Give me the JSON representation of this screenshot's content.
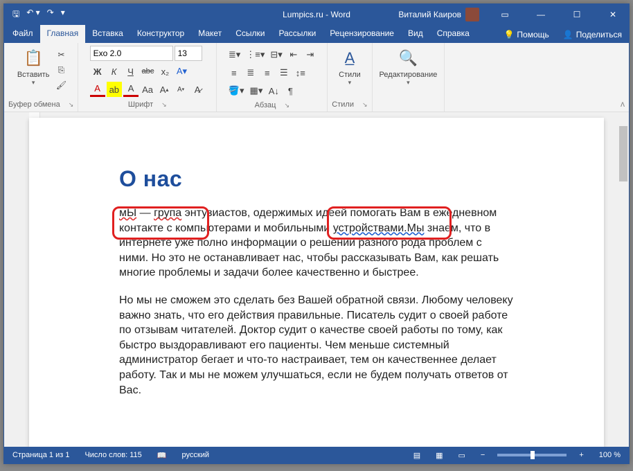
{
  "title": "Lumpics.ru - Word",
  "user_name": "Виталий Каиров",
  "tabs": {
    "file": "Файл",
    "home": "Главная",
    "insert": "Вставка",
    "design": "Конструктор",
    "layout": "Макет",
    "references": "Ссылки",
    "mailings": "Рассылки",
    "review": "Рецензирование",
    "view": "Вид",
    "help": "Справка",
    "tell": "Помощь",
    "share": "Поделиться"
  },
  "ribbon": {
    "clipboard": {
      "label": "Буфер обмена",
      "paste": "Вставить"
    },
    "font": {
      "label": "Шрифт",
      "name": "Exo 2.0",
      "size": "13",
      "btns": {
        "bold": "Ж",
        "italic": "К",
        "underline": "Ч",
        "strike": "abє",
        "sub": "x₂",
        "fontcolorA": "A",
        "highlightA": "A",
        "caseAa": "Aa",
        "grow": "A",
        "shrink": "A",
        "clear": "A"
      }
    },
    "paragraph": {
      "label": "Абзац"
    },
    "styles": {
      "label": "Стили",
      "btn": "Стили"
    },
    "editing": {
      "label": "Редактирование"
    }
  },
  "doc": {
    "heading": "О нас",
    "p1_frag1": "мЫ",
    "p1_frag2": " — ",
    "p1_frag3": "група",
    "p1_frag4": " энтузиастов, одержимых идеей помогать Вам в ежедневном контакте с компьютерами и мобильными ",
    "p1_frag5": "устройствами.Мы",
    "p1_frag6": " знаем, что в интернете уже полно информации о решении разного рода проблем с ними. Но это не останавливает нас, чтобы рассказывать Вам, как решать многие проблемы и задачи более качественно и быстрее.",
    "p2": "Но мы не сможем это сделать без Вашей обратной связи. Любому человеку важно знать, что его действия правильные. Писатель судит о своей работе по отзывам читателей. Доктор судит о качестве своей работы по тому, как быстро выздоравливают его пациенты. Чем меньше системный администратор бегает и что-то настраивает, тем он качественнее делает работу. Так и мы не можем улучшаться, если не будем получать ответов от Вас."
  },
  "status": {
    "page": "Страница 1 из 1",
    "words": "Число слов: 115",
    "lang": "русский",
    "zoom": "100 %"
  }
}
